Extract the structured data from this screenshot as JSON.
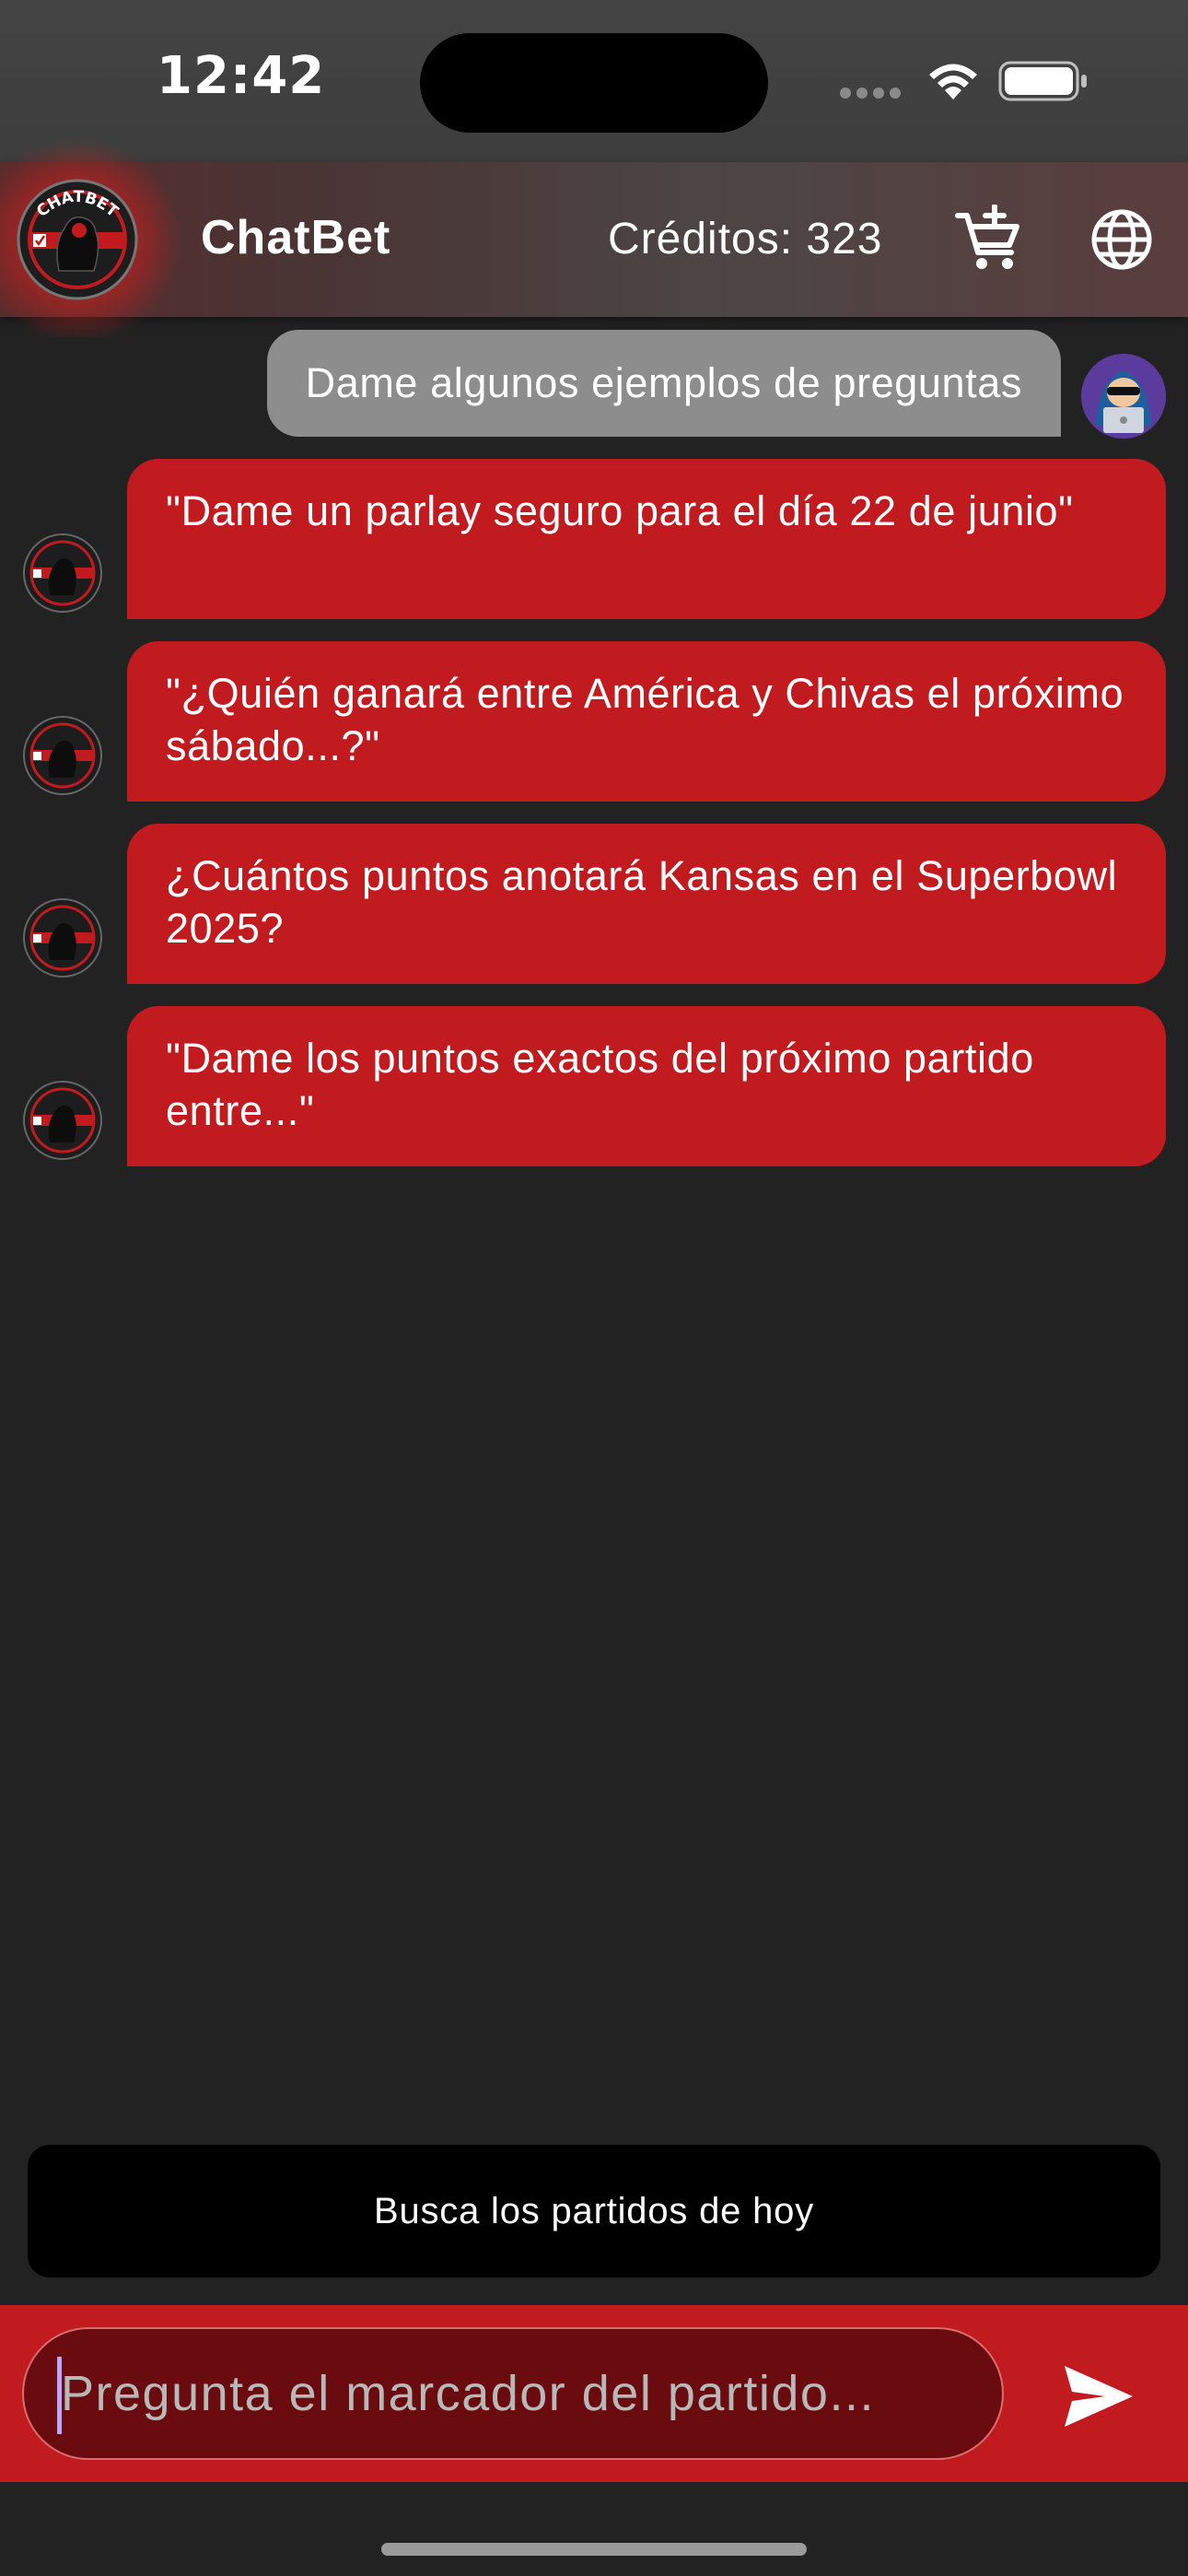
{
  "status_bar": {
    "time": "12:42",
    "icons": [
      "signal-dots-icon",
      "wifi-icon",
      "battery-icon"
    ]
  },
  "header": {
    "logo_icon": "chatbet-logo-icon",
    "logo_text": "CHATBET",
    "title": "ChatBet",
    "credits": "Créditos: 323",
    "cart_icon": "add-to-cart-icon",
    "language_icon": "globe-icon"
  },
  "messages": [
    {
      "sender": "user",
      "avatar_icon": "hacker-avatar-icon",
      "text": "Dame algunos ejemplos de preguntas"
    },
    {
      "sender": "bot",
      "avatar_icon": "chatbet-logo-icon",
      "text": "\"Dame un parlay seguro para el día 22 de junio\""
    },
    {
      "sender": "bot",
      "avatar_icon": "chatbet-logo-icon",
      "text": "\"¿Quién ganará entre América y Chivas el próximo sábado...?\""
    },
    {
      "sender": "bot",
      "avatar_icon": "chatbet-logo-icon",
      "text": "¿Cuántos puntos anotará Kansas en el Superbowl 2025?"
    },
    {
      "sender": "bot",
      "avatar_icon": "chatbet-logo-icon",
      "text": "\"Dame los puntos exactos del próximo partido entre...\""
    }
  ],
  "quick_action": {
    "label": "Busca los partidos de hoy"
  },
  "composer": {
    "value": "",
    "placeholder": "Pregunta el marcador del partido...",
    "send_icon": "send-icon"
  },
  "colors": {
    "background": "#222222",
    "accent_red": "#c21b1f",
    "input_dark_red": "#6a0c0f",
    "user_bubble": "#8d8d8d",
    "quick_button": "#000000"
  }
}
